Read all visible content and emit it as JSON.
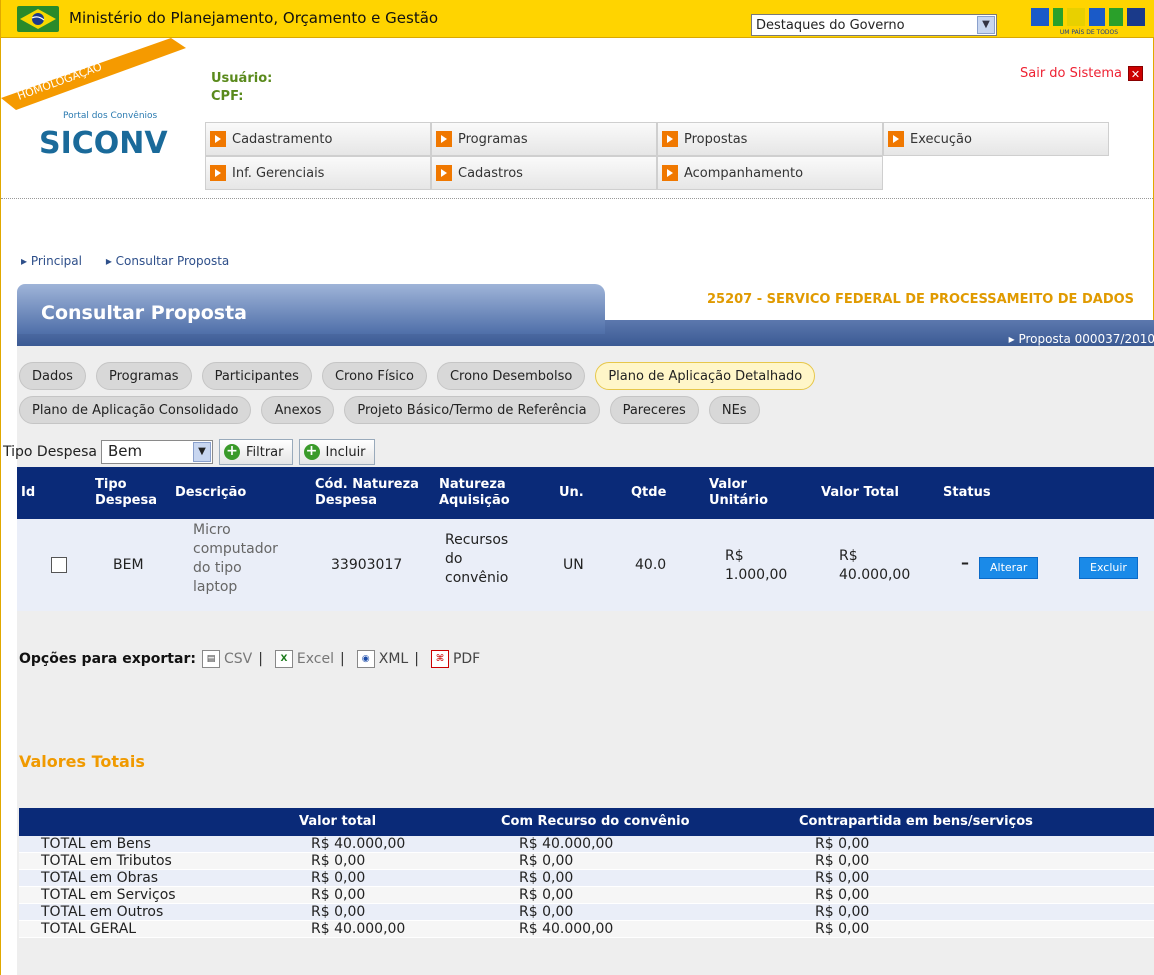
{
  "topbar": {
    "ministry": "Ministério do Planejamento, Orçamento e Gestão",
    "gov_select": "Destaques do Governo",
    "brand": "BRASIL",
    "brand_sub": "UM PAÍS DE TODOS"
  },
  "logo": {
    "ribbon": "HOMOLOGAÇÃO",
    "portal": "Portal dos Convênios",
    "name": "SICONV"
  },
  "user": {
    "user_label": "Usuário:",
    "cpf_label": "CPF:"
  },
  "logout": "Sair do Sistema",
  "menu": {
    "row1": [
      "Cadastramento",
      "Programas",
      "Propostas",
      "Execução"
    ],
    "row2": [
      "Inf. Gerenciais",
      "Cadastros",
      "Acompanhamento"
    ]
  },
  "breadcrumb": [
    "Principal",
    "Consultar Proposta"
  ],
  "page_title": "Consultar Proposta",
  "org": "25207 - SERVICO FEDERAL DE PROCESSAMEITO DE DADOS",
  "proposal": "Proposta 000037/2010",
  "tabs": {
    "row1": [
      "Dados",
      "Programas",
      "Participantes",
      "Crono Físico",
      "Crono Desembolso",
      "Plano de Aplicação Detalhado"
    ],
    "row2": [
      "Plano de Aplicação Consolidado",
      "Anexos",
      "Projeto Básico/Termo de Referência",
      "Pareceres",
      "NEs"
    ],
    "active": "Plano de Aplicação Detalhado"
  },
  "filter": {
    "label": "Tipo Despesa",
    "value": "Bem",
    "filter_btn": "Filtrar",
    "add_btn": "Incluir"
  },
  "table": {
    "headers": {
      "id": "Id",
      "tipo1": "Tipo",
      "tipo2": "Despesa",
      "descricao": "Descrição",
      "cod1": "Cód. Natureza",
      "cod2": "Despesa",
      "nat1": "Natureza",
      "nat2": "Aquisição",
      "un": "Un.",
      "qtde": "Qtde",
      "vu1": "Valor",
      "vu2": "Unitário",
      "vt": "Valor Total",
      "status": "Status"
    },
    "row": {
      "tipo": "BEM",
      "descricao": [
        "Micro",
        "computador",
        "do tipo",
        "laptop"
      ],
      "cod": "33903017",
      "natureza": [
        "Recursos",
        "do",
        "convênio"
      ],
      "un": "UN",
      "qtde": "40.0",
      "vu": [
        "R$",
        "1.000,00"
      ],
      "vt": [
        "R$",
        "40.000,00"
      ],
      "status": "–",
      "alterar": "Alterar",
      "excluir": "Excluir"
    }
  },
  "export": {
    "label": "Opções para exportar:",
    "options": [
      "CSV",
      "Excel",
      "XML",
      "PDF"
    ]
  },
  "totals": {
    "title": "Valores Totais",
    "headers": [
      "Valor total",
      "Com Recurso do convênio",
      "Contrapartida em bens/serviços"
    ],
    "rows": [
      [
        "TOTAL em Bens",
        "R$ 40.000,00",
        "R$ 40.000,00",
        "R$ 0,00"
      ],
      [
        "TOTAL em Tributos",
        "R$ 0,00",
        "R$ 0,00",
        "R$ 0,00"
      ],
      [
        "TOTAL em Obras",
        "R$ 0,00",
        "R$ 0,00",
        "R$ 0,00"
      ],
      [
        "TOTAL em Serviços",
        "R$ 0,00",
        "R$ 0,00",
        "R$ 0,00"
      ],
      [
        "TOTAL em Outros",
        "R$ 0,00",
        "R$ 0,00",
        "R$ 0,00"
      ],
      [
        "TOTAL GERAL",
        "R$ 40.000,00",
        "R$ 40.000,00",
        "R$ 0,00"
      ]
    ]
  }
}
